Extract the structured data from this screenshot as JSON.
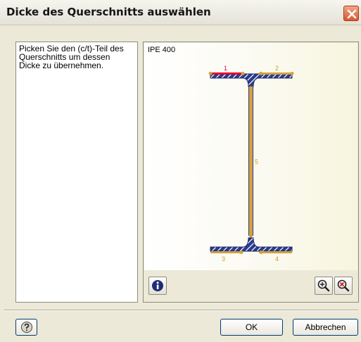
{
  "window": {
    "title": "Dicke des Querschnitts auswählen"
  },
  "instructions": "Picken Sie den (c/t)-Teil des Querschnitts um dessen Dicke zu übernehmen.",
  "section": {
    "name": "IPE 400",
    "part_labels": [
      "1",
      "2",
      "3",
      "4",
      "5"
    ],
    "selected_part": "1"
  },
  "colors": {
    "selected_part": "#e4002b",
    "part": "#d4a23a",
    "profile_fill": "#2a3a8c",
    "part_label": "#d39a2a"
  },
  "toolbar": {
    "info_icon": "info-icon",
    "zoom_in_icon": "zoom-in-icon",
    "zoom_reset_icon": "zoom-reset-icon"
  },
  "footer": {
    "help_icon": "help-icon",
    "ok_label": "OK",
    "cancel_label": "Abbrechen"
  }
}
